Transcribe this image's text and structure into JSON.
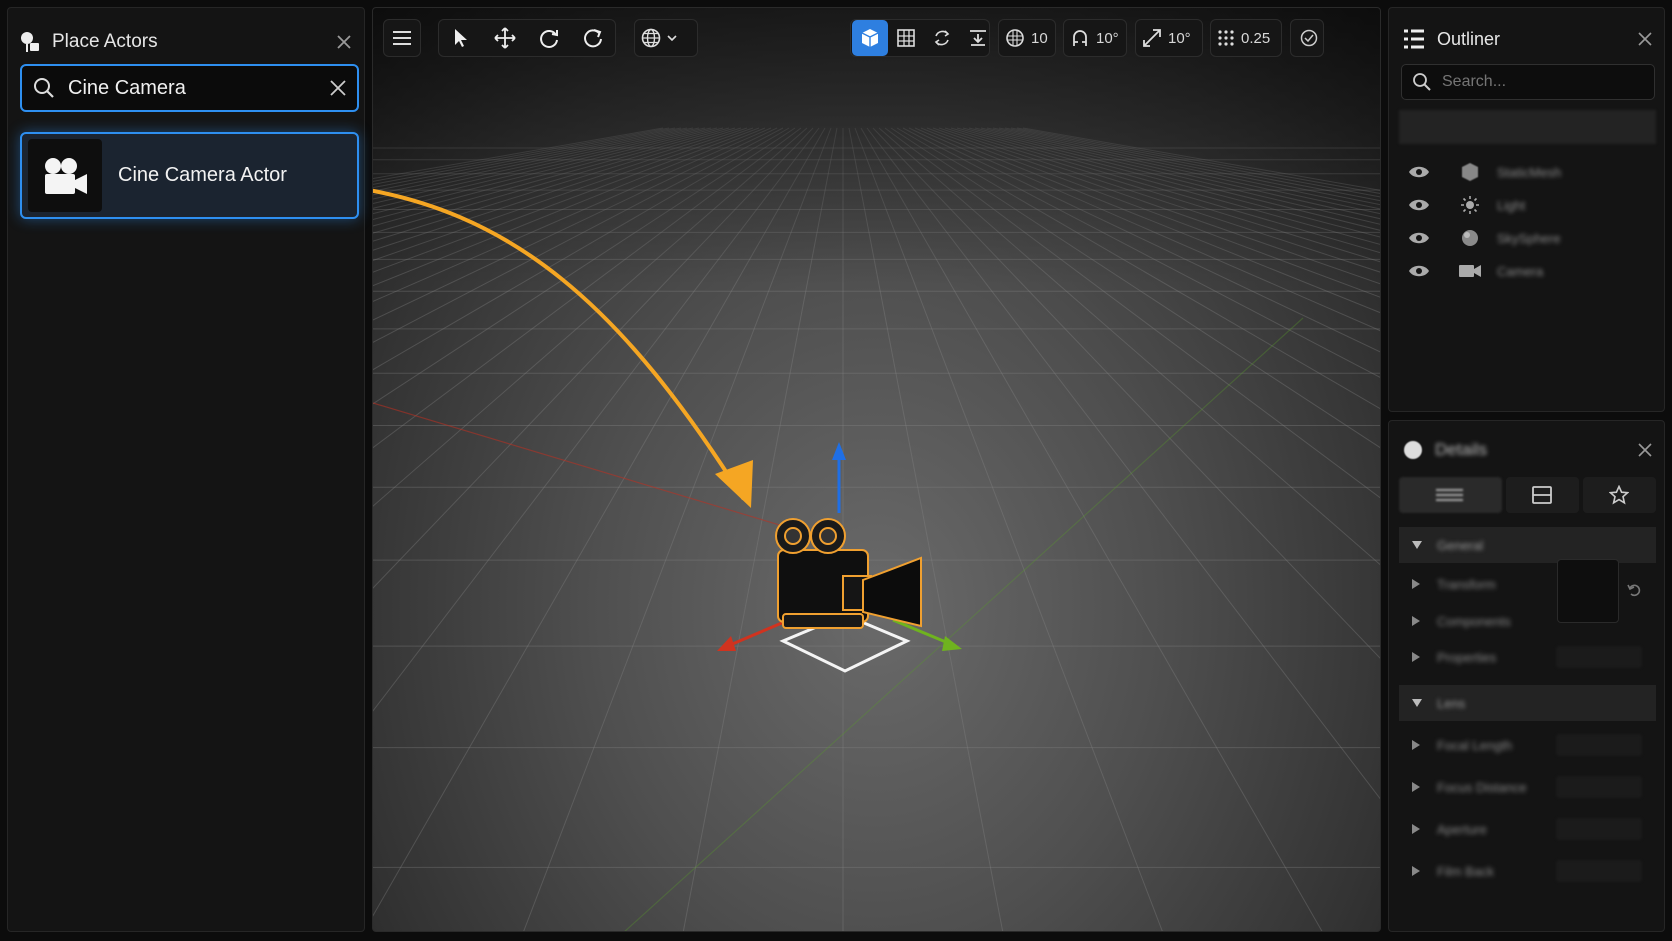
{
  "place_actors": {
    "title": "Place Actors",
    "search_value": "Cine Camera",
    "result_label": "Cine Camera Actor"
  },
  "toolbar": {
    "grid_snap_value": "10",
    "rotation_snap_value": "10°",
    "scale_snap_value": "10°",
    "speed_value": "0.25"
  },
  "outliner": {
    "title": "Outliner",
    "search_placeholder": "Search...",
    "rows": [
      {
        "icon": "cube-icon",
        "label": "StaticMesh"
      },
      {
        "icon": "sun-icon",
        "label": "Light"
      },
      {
        "icon": "sphere-icon",
        "label": "SkySphere"
      },
      {
        "icon": "camera-icon",
        "label": "Camera"
      }
    ]
  },
  "details": {
    "title": "Details",
    "sections": [
      "General",
      "Lens"
    ],
    "properties_a": [
      "Transform",
      "Components",
      "Properties"
    ],
    "properties_b": [
      "Focal Length",
      "Focus Distance",
      "Aperture",
      "Film Back"
    ]
  },
  "colors": {
    "accent": "#2e8ff0",
    "arrow": "#f5a623",
    "axis_x": "#d0331f",
    "axis_y": "#6fb31f",
    "axis_z": "#1f6fe6"
  }
}
